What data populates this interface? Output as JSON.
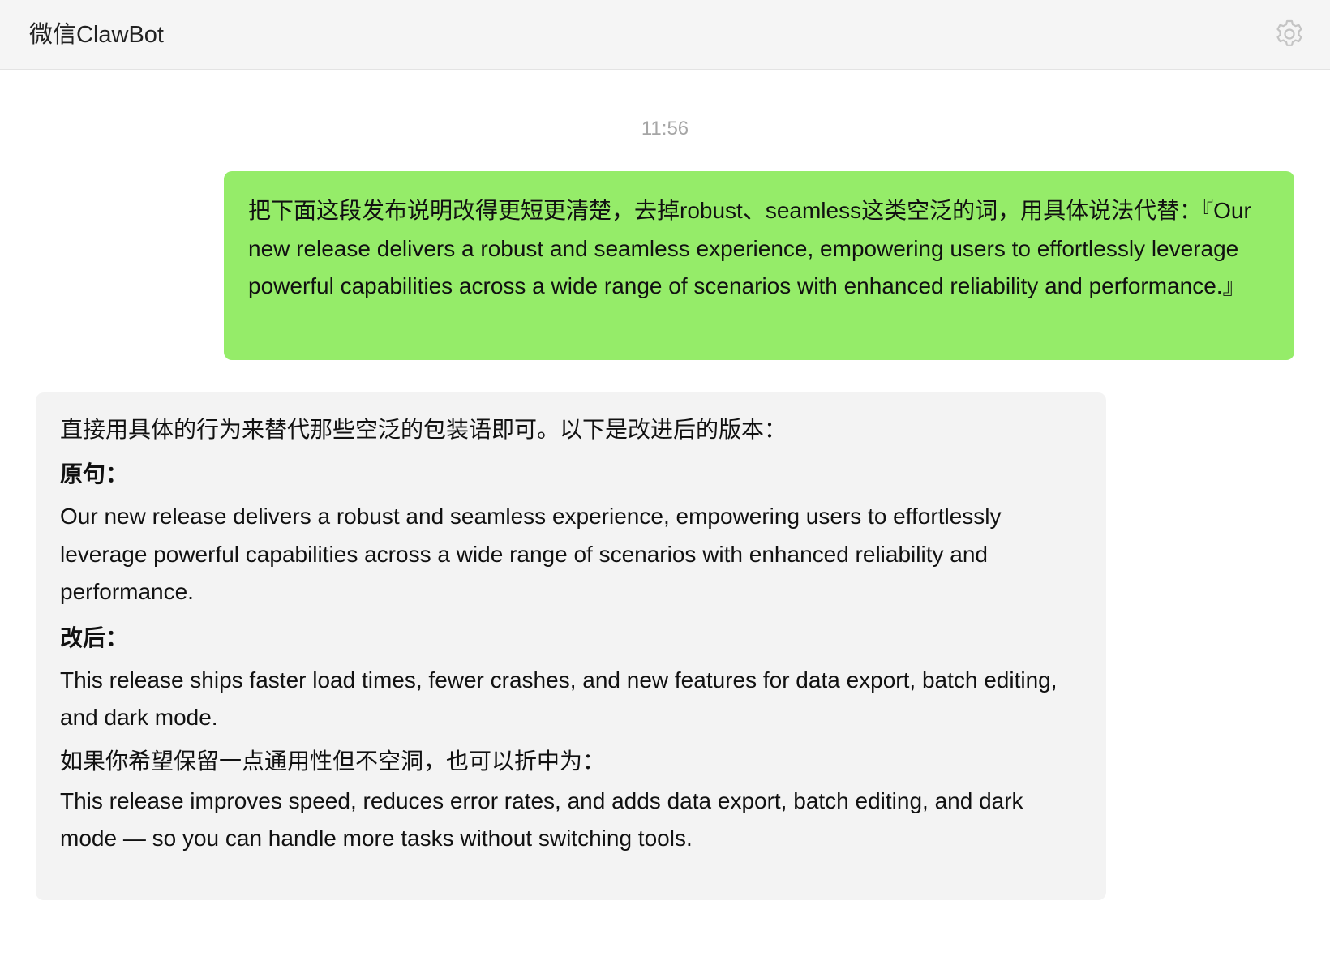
{
  "window": {
    "title": "微信ClawBot",
    "settings_icon": "gear-icon"
  },
  "chat": {
    "timestamp": "11:56",
    "user_message": "把下面这段发布说明改得更短更清楚，去掉robust、seamless这类空泛的词，用具体说法代替：『Our new release delivers a robust and seamless experience, empowering users to effortlessly leverage powerful capabilities across a wide range of scenarios with enhanced reliability and performance.』",
    "bot_reply": {
      "intro": "直接用具体的行为来替代那些空泛的包装语即可。以下是改进后的版本：",
      "original_label": "原句：",
      "original_text": "Our new release delivers a robust and seamless experience, empowering users to effortlessly leverage powerful capabilities across a wide range of scenarios with enhanced reliability and performance.",
      "revised_label": "改后：",
      "revised_text": "This release ships faster load times, fewer crashes, and new features for data export, batch editing, and dark mode.",
      "compromise_intro": "如果你希望保留一点通用性但不空洞，也可以折中为：",
      "compromise_text": "This release improves speed, reduces error rates, and adds data export, batch editing, and dark mode — so you can handle more tasks without switching tools."
    }
  },
  "colors": {
    "titlebar_bg": "#f5f5f5",
    "user_bubble": "#95ec69",
    "bot_bubble": "#f3f3f3",
    "timestamp": "#a6a6a6"
  }
}
